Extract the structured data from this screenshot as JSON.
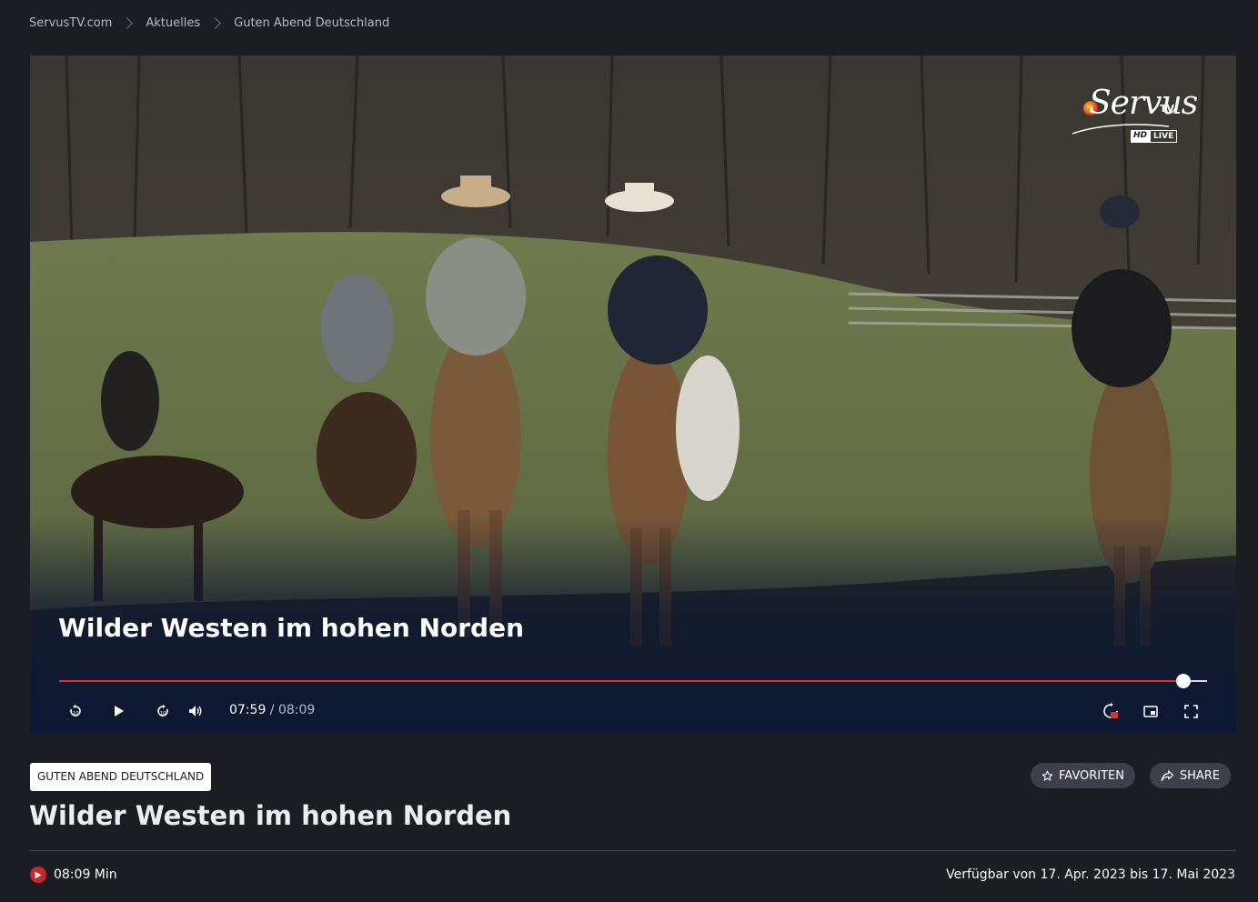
{
  "breadcrumb": {
    "items": [
      "ServusTV.com",
      "Aktuelles",
      "Guten Abend Deutschland"
    ]
  },
  "player": {
    "logo": {
      "word": "Servus",
      "suffix": "TV",
      "badge_hd": "HD",
      "badge_live": "LIVE"
    },
    "title": "Wilder Westen im hohen Norden",
    "progress_fraction": 0.9794,
    "time_current": "07:59",
    "time_separator": " / ",
    "time_total": "08:09",
    "controls": [
      "replay-10-icon",
      "play-icon",
      "forward-10-icon",
      "volume-icon",
      "hd-quality-icon",
      "picture-in-picture-icon",
      "fullscreen-icon"
    ]
  },
  "meta": {
    "tag": "GUTEN ABEND DEUTSCHLAND",
    "favorite_label": "FAVORITEN",
    "share_label": "SHARE",
    "title": "Wilder Westen im hohen Norden",
    "duration": "08:09 Min",
    "availability": "Verfügbar von 17. Apr. 2023 bis 17. Mai 2023"
  },
  "colors": {
    "background": "#1c1d22",
    "progress": "#e22d2d",
    "pill": "#3d4048",
    "duration_icon": "#c8262b"
  }
}
